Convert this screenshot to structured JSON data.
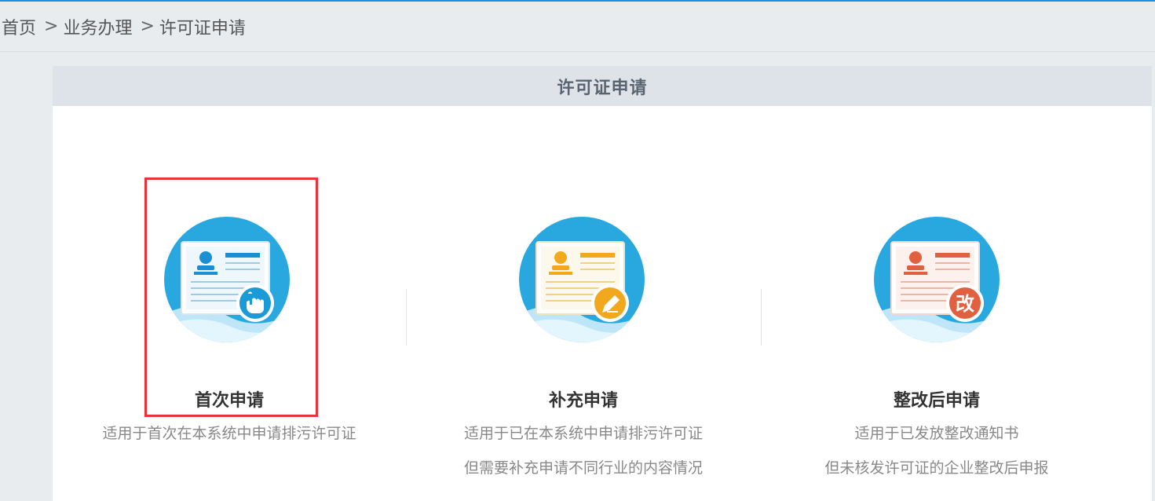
{
  "breadcrumb": {
    "items": [
      "首页",
      "业务办理",
      "许可证申请"
    ],
    "separator": ">"
  },
  "panel": {
    "title": "许可证申请"
  },
  "cards": [
    {
      "title": "首次申请",
      "desc_line1": "适用于首次在本系统中申请排污许可证",
      "desc_line2": "",
      "badge_icon": "hand-pointer-icon",
      "accent": "#1a9ad6"
    },
    {
      "title": "补充申请",
      "desc_line1": "适用于已在本系统中申请排污许可证",
      "desc_line2": "但需要补充申请不同行业的内容情况",
      "badge_icon": "pencil-icon",
      "accent": "#f2a81d"
    },
    {
      "title": "整改后申请",
      "desc_line1": "适用于已发放整改通知书",
      "desc_line2": "但未核发许可证的企业整改后申报",
      "badge_icon": "gai-char-icon",
      "badge_text": "改",
      "accent": "#e0603f"
    }
  ],
  "colors": {
    "top_line": "#1a8fe3",
    "highlight_border": "#e8333b",
    "icon_circle": "#29a8e0"
  }
}
